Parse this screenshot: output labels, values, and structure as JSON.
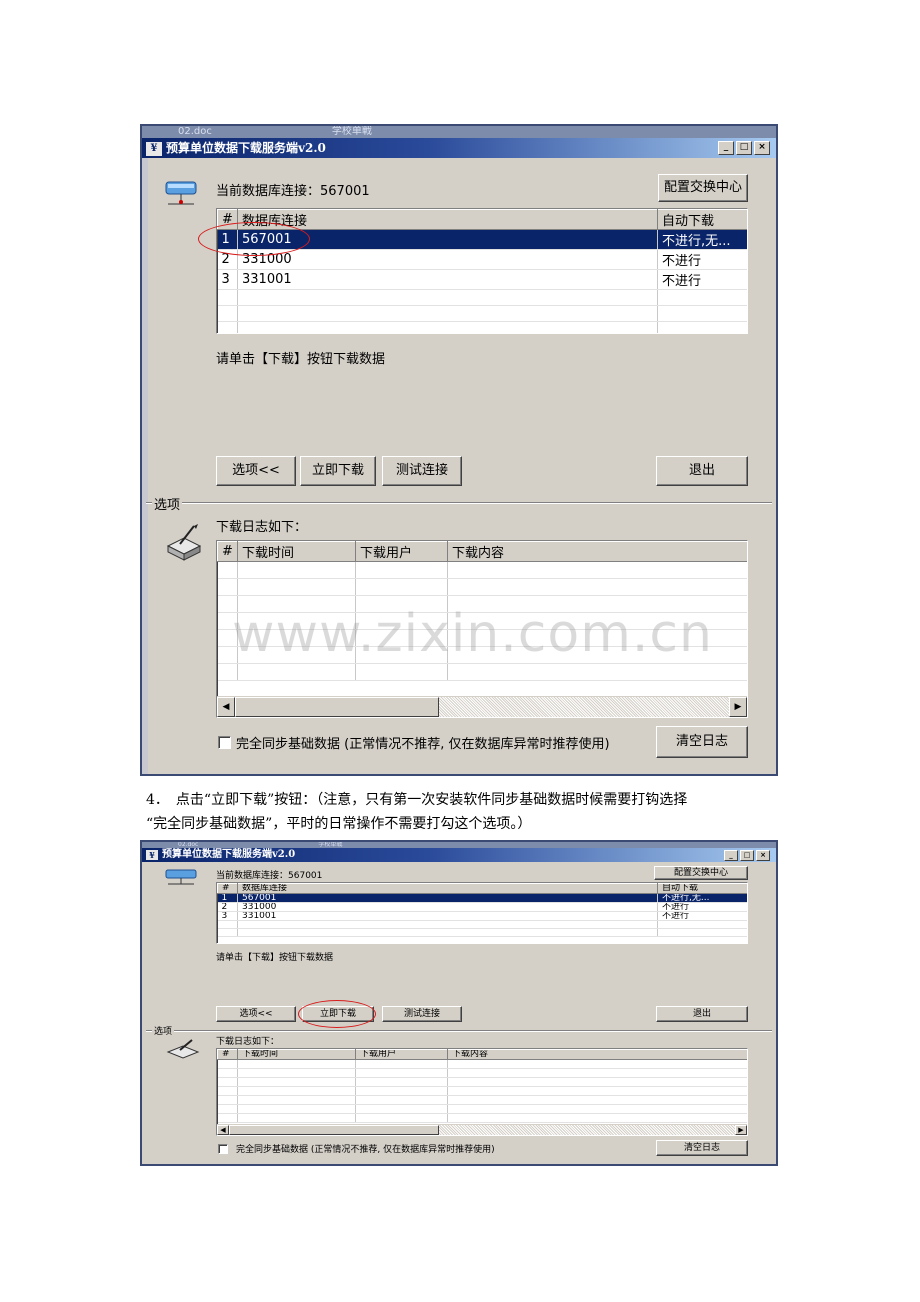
{
  "window": {
    "behind_text_1": "02.doc",
    "behind_text_2": "学校单戰",
    "title": "预算单位数据下载服务端v2.0",
    "app_icon": "¥",
    "min_glyph": "_",
    "max_glyph": "□",
    "close_glyph": "×"
  },
  "main": {
    "connection_label": "当前数据库连接：",
    "connection_value": "567001",
    "config_button": "配置交换中心",
    "db_table": {
      "headers": [
        "#",
        "数据库连接",
        "自动下载"
      ],
      "rows": [
        [
          "1",
          "567001",
          "不进行,无..."
        ],
        [
          "2",
          "331000",
          "不进行"
        ],
        [
          "3",
          "331001",
          "不进行"
        ]
      ],
      "selected_row": 1
    },
    "hint": "请单击【下载】按钮下载数据",
    "buttons": {
      "options": "选项<<",
      "download_now": "立即下载",
      "test_connection": "测试连接",
      "exit": "退出"
    }
  },
  "options": {
    "group_label": "选项",
    "log_label": "下载日志如下：",
    "log_table": {
      "headers": [
        "#",
        "下载时间",
        "下载用户",
        "下载内容"
      ]
    },
    "full_sync_checkbox": "完全同步基础数据 (正常情况不推荐, 仅在数据库异常时推荐使用)",
    "full_sync_checked": false,
    "clear_log_button": "清空日志"
  },
  "scroll": {
    "left_glyph": "◀",
    "right_glyph": "▶"
  },
  "watermark": "www.zixin.com.cn",
  "step_text": {
    "line1": "4．　点击“立即下载”按钮：（注意，只有第一次安装软件同步基础数据时候需要打钩选择",
    "line2": "“完全同步基础数据”，平时的日常操作不需要打勾这个选项。）"
  },
  "colors": {
    "titlebar": "#0a246a",
    "selection": "#0a246a",
    "dialog_face": "#d4d0c8",
    "annotation": "#d81b1b"
  }
}
